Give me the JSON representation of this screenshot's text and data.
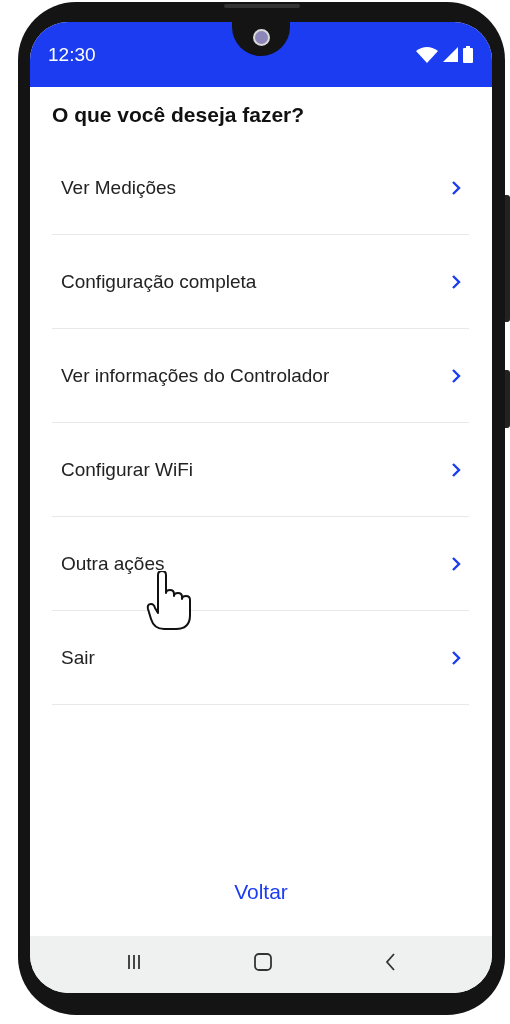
{
  "status_bar": {
    "time": "12:30"
  },
  "title": "O que você deseja fazer?",
  "menu_items": [
    {
      "label": "Ver Medições"
    },
    {
      "label": "Configuração completa"
    },
    {
      "label": "Ver informações do Controlador"
    },
    {
      "label": "Configurar WiFi"
    },
    {
      "label": "Outra ações"
    },
    {
      "label": "Sair"
    }
  ],
  "back_button": {
    "label": "Voltar"
  }
}
